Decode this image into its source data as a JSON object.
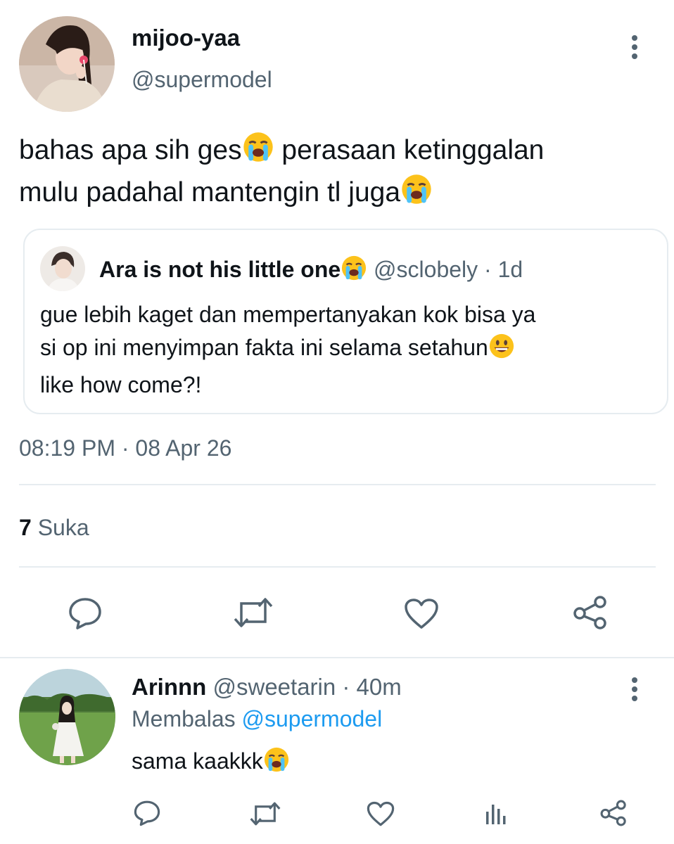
{
  "tweet": {
    "display_name": "mijoo-yaa",
    "handle": "@supermodel",
    "text_line1": "bahas apa sih ges",
    "text_line1b": " perasaan ketinggalan",
    "text_line2": "mulu padahal mantengin tl juga",
    "timestamp": "08:19 PM · 08 Apr 26",
    "likes_count": "7",
    "likes_label": " Suka",
    "more_icon": "more-vertical-icon"
  },
  "quoted": {
    "display_name": "Ara is not his little one",
    "meta": " @sclobely · 1d",
    "line1": "gue lebih kaget dan mempertanyakan kok bisa ya",
    "line2": "si op ini menyimpan fakta ini selama setahun",
    "line3": "like how come?!"
  },
  "actions": [
    "reply-icon",
    "retweet-icon",
    "like-icon",
    "share-icon"
  ],
  "reply": {
    "display_name": "Arinnn",
    "meta": " @sweetarin · 40m",
    "replying_label": "Membalas ",
    "replying_handle": "@supermodel",
    "text": "sama kaakkk",
    "actions": [
      "reply-icon",
      "retweet-icon",
      "like-icon",
      "analytics-icon",
      "share-icon"
    ]
  },
  "colors": {
    "text_primary": "#0f1419",
    "text_secondary": "#536471",
    "link": "#1d9bf0",
    "divider": "#e6ecf0"
  }
}
